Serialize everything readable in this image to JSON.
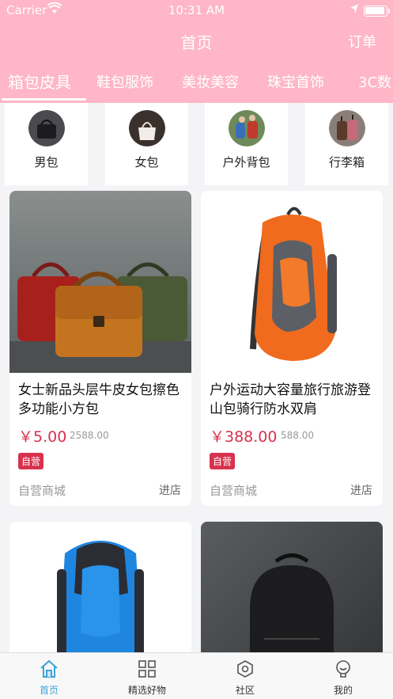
{
  "status_bar": {
    "carrier": "Carrier",
    "time": "10:31 AM"
  },
  "nav": {
    "title": "首页",
    "right_action": "订单"
  },
  "tabs": [
    "箱包皮具",
    "鞋包服饰",
    "美妆美容",
    "珠宝首饰",
    "3C数"
  ],
  "active_tab_index": 0,
  "categories": [
    {
      "label": "男包",
      "icon": "mens-bag-thumb"
    },
    {
      "label": "女包",
      "icon": "womens-bag-thumb"
    },
    {
      "label": "户外背包",
      "icon": "outdoor-backpack-thumb"
    },
    {
      "label": "行李箱",
      "icon": "luggage-thumb"
    }
  ],
  "products": [
    {
      "title": "女士新品头层牛皮女包擦色多功能小方包",
      "price": "￥5.00",
      "original_price": "2588.00",
      "badge": "自营",
      "shop": "自营商城",
      "enter": "进店"
    },
    {
      "title": "户外运动大容量旅行旅游登山包骑行防水双肩",
      "price": "￥388.00",
      "original_price": "588.00",
      "badge": "自营",
      "shop": "自营商城",
      "enter": "进店"
    },
    {
      "title": "",
      "price": "",
      "original_price": "",
      "badge": "",
      "shop": "",
      "enter": ""
    },
    {
      "title": "",
      "price": "",
      "original_price": "",
      "badge": "",
      "shop": "",
      "enter": ""
    }
  ],
  "tabbar": [
    {
      "label": "首页",
      "icon": "home-icon"
    },
    {
      "label": "精选好物",
      "icon": "grid-icon"
    },
    {
      "label": "社区",
      "icon": "community-icon"
    },
    {
      "label": "我的",
      "icon": "profile-icon"
    }
  ],
  "colors": {
    "header_pink": "#ffb6c6",
    "price_red": "#d8324e",
    "tab_active_blue": "#3aa3dc"
  }
}
